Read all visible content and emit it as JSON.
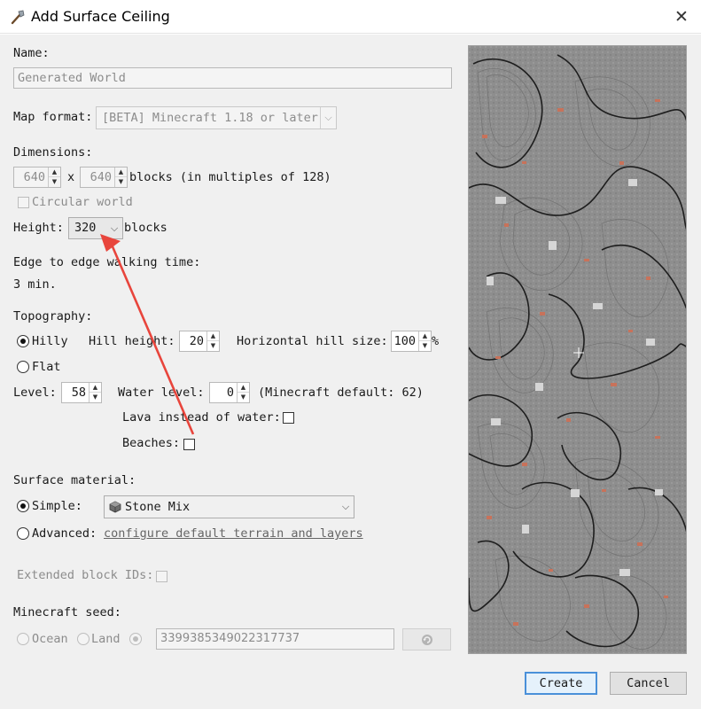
{
  "window": {
    "title": "Add Surface Ceiling",
    "close_glyph": "✕"
  },
  "name": {
    "label": "Name:",
    "value": "Generated World"
  },
  "map_format": {
    "label": "Map format:",
    "selected": "[BETA] Minecraft 1.18 or later"
  },
  "dimensions": {
    "label": "Dimensions:",
    "width": "640",
    "separator": "x",
    "height": "640",
    "suffix": "blocks (in multiples of 128)",
    "circular_label": "Circular world",
    "circular_checked": false
  },
  "height": {
    "label": "Height:",
    "selected": "320",
    "suffix": "blocks"
  },
  "edge": {
    "label": "Edge to edge walking time:",
    "value": "3 min."
  },
  "topography": {
    "label": "Topography:",
    "hilly_label": "Hilly",
    "hilly_selected": true,
    "hill_height_label": "Hill height:",
    "hill_height": "20",
    "horizontal_label": "Horizontal hill size:",
    "horizontal_value": "100",
    "horizontal_unit": "%",
    "flat_label": "Flat",
    "level_label": "Level:",
    "level": "58",
    "water_label": "Water level:",
    "water_level": "0",
    "water_default": "(Minecraft default: 62)",
    "lava_label": "Lava instead of water:",
    "lava_checked": false,
    "beaches_label": "Beaches:",
    "beaches_checked": false
  },
  "surface": {
    "label": "Surface material:",
    "simple_label": "Simple:",
    "simple_selected": true,
    "material": "Stone Mix",
    "material_icon": "stone-block-icon",
    "advanced_label": "Advanced:",
    "advanced_link": "configure default terrain and layers"
  },
  "extended_ids": {
    "label": "Extended block IDs:",
    "checked": false
  },
  "seed": {
    "label": "Minecraft seed:",
    "ocean_label": "Ocean",
    "land_label": "Land",
    "value": "3399385349022317737",
    "refresh_icon": "refresh-icon"
  },
  "buttons": {
    "create": "Create",
    "cancel": "Cancel"
  },
  "colors": {
    "dialog_bg": "#f0f0f0",
    "accent": "#4a90d9",
    "annotation_arrow": "#e8453c",
    "preview_stone": "#8e8e8e",
    "preview_ore": "#c8725a"
  }
}
